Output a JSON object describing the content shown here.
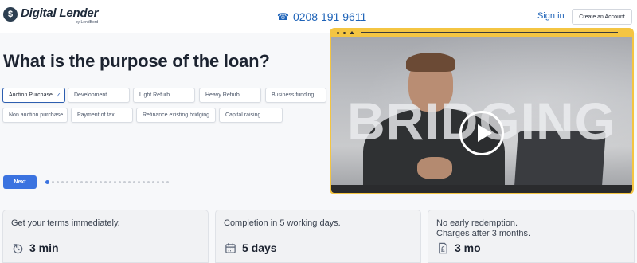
{
  "header": {
    "logo_mark": "$",
    "logo_title": "Digital Lender",
    "logo_sub": "by LendBord",
    "phone_icon": "phone-icon",
    "phone": "0208 191 9611",
    "signin_label": "Sign in",
    "create_account_label": "Create an Account",
    "accent_color": "#1e63b8"
  },
  "question": {
    "title": "What is the purpose of the loan?",
    "options": [
      {
        "label": "Auction Purchase",
        "selected": true
      },
      {
        "label": "Development",
        "selected": false
      },
      {
        "label": "Light Refurb",
        "selected": false
      },
      {
        "label": "Heavy Refurb",
        "selected": false
      },
      {
        "label": "Business funding",
        "selected": false
      },
      {
        "label": "Non auction purchase",
        "selected": false
      },
      {
        "label": "Payment of tax",
        "selected": false
      },
      {
        "label": "Refinance existing bridging",
        "selected": false
      },
      {
        "label": "Capital raising",
        "selected": false
      }
    ],
    "selected_check": "✓",
    "next_label": "Next",
    "steps_total": 26,
    "step_current": 1
  },
  "video": {
    "overlay_text": "BRIDGING",
    "frame_color": "#f4c542",
    "play_icon": "play-icon"
  },
  "cards": [
    {
      "title": "Get your terms immediately.",
      "icon": "clock-arrow-icon",
      "value": "3 min"
    },
    {
      "title": "Completion in 5 working days.",
      "icon": "calendar-icon",
      "value": "5 days"
    },
    {
      "title": "No early redemption. Charges after 3 months.",
      "icon": "document-pound-icon",
      "value": "3 mo"
    }
  ]
}
